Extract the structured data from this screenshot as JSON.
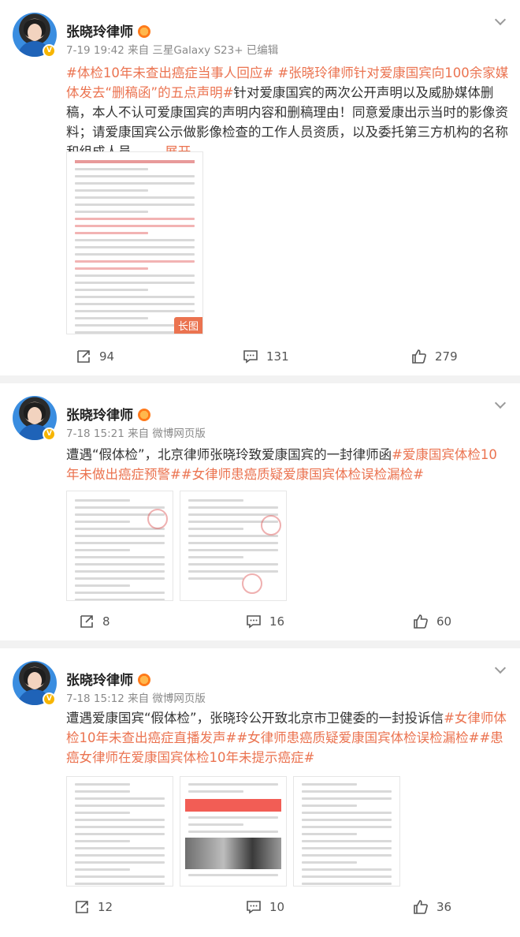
{
  "posts": [
    {
      "author": "张晓玲律师",
      "meta": "7-19 19:42  来自 三星Galaxy S23+  已编辑",
      "text_parts": [
        {
          "text": "#体检10年未查出癌症当事人回应#",
          "tag": true
        },
        {
          "text": " ",
          "tag": false
        },
        {
          "text": "#张晓玲律师针对爱康国宾向100余家媒体发去“删稿函”的五点声明#",
          "tag": true
        },
        {
          "text": "针对爱康国宾的两次公开声明以及威胁媒体删稿，本人不认可爱康国宾的声明内容和删稿理由！同意爱康出示当时的影像资料；请爱康国宾公示做影像检查的工作人员资质，以及委托第三方机构的名称和组成人员、 ... ",
          "tag": false
        }
      ],
      "more_label": "展开",
      "long_image_label": "长图",
      "reposts": "94",
      "comments": "131",
      "likes": "279"
    },
    {
      "author": "张晓玲律师",
      "meta": "7-18 15:21  来自 微博网页版",
      "text_parts": [
        {
          "text": "遭遇“假体检”，北京律师张晓玲致爱康国宾的一封律师函",
          "tag": false
        },
        {
          "text": "#爱康国宾体检10年未做出癌症预警#",
          "tag": true
        },
        {
          "text": "#女律师患癌质疑爱康国宾体检误检漏检#",
          "tag": true
        }
      ],
      "reposts": "8",
      "comments": "16",
      "likes": "60"
    },
    {
      "author": "张晓玲律师",
      "meta": "7-18 15:12  来自 微博网页版",
      "text_parts": [
        {
          "text": "遭遇爱康国宾“假体检”，张晓玲公开致北京市卫健委的一封投诉信",
          "tag": false
        },
        {
          "text": "#女律师体检10年未查出癌症直播发声#",
          "tag": true
        },
        {
          "text": "#女律师患癌质疑爱康国宾体检误检漏检#",
          "tag": true
        },
        {
          "text": "#患癌女律师在爱康国宾体检10年未提示癌症#",
          "tag": true
        }
      ],
      "reposts": "12",
      "comments": "10",
      "likes": "36"
    }
  ],
  "colors": {
    "accent": "#eb7350",
    "vip_badge": "#f7b500",
    "meta_gray": "#8a8a8a"
  },
  "icons": {
    "repost": "repost-icon",
    "comment": "comment-icon",
    "like": "like-icon",
    "menu": "chevron-down-icon"
  }
}
